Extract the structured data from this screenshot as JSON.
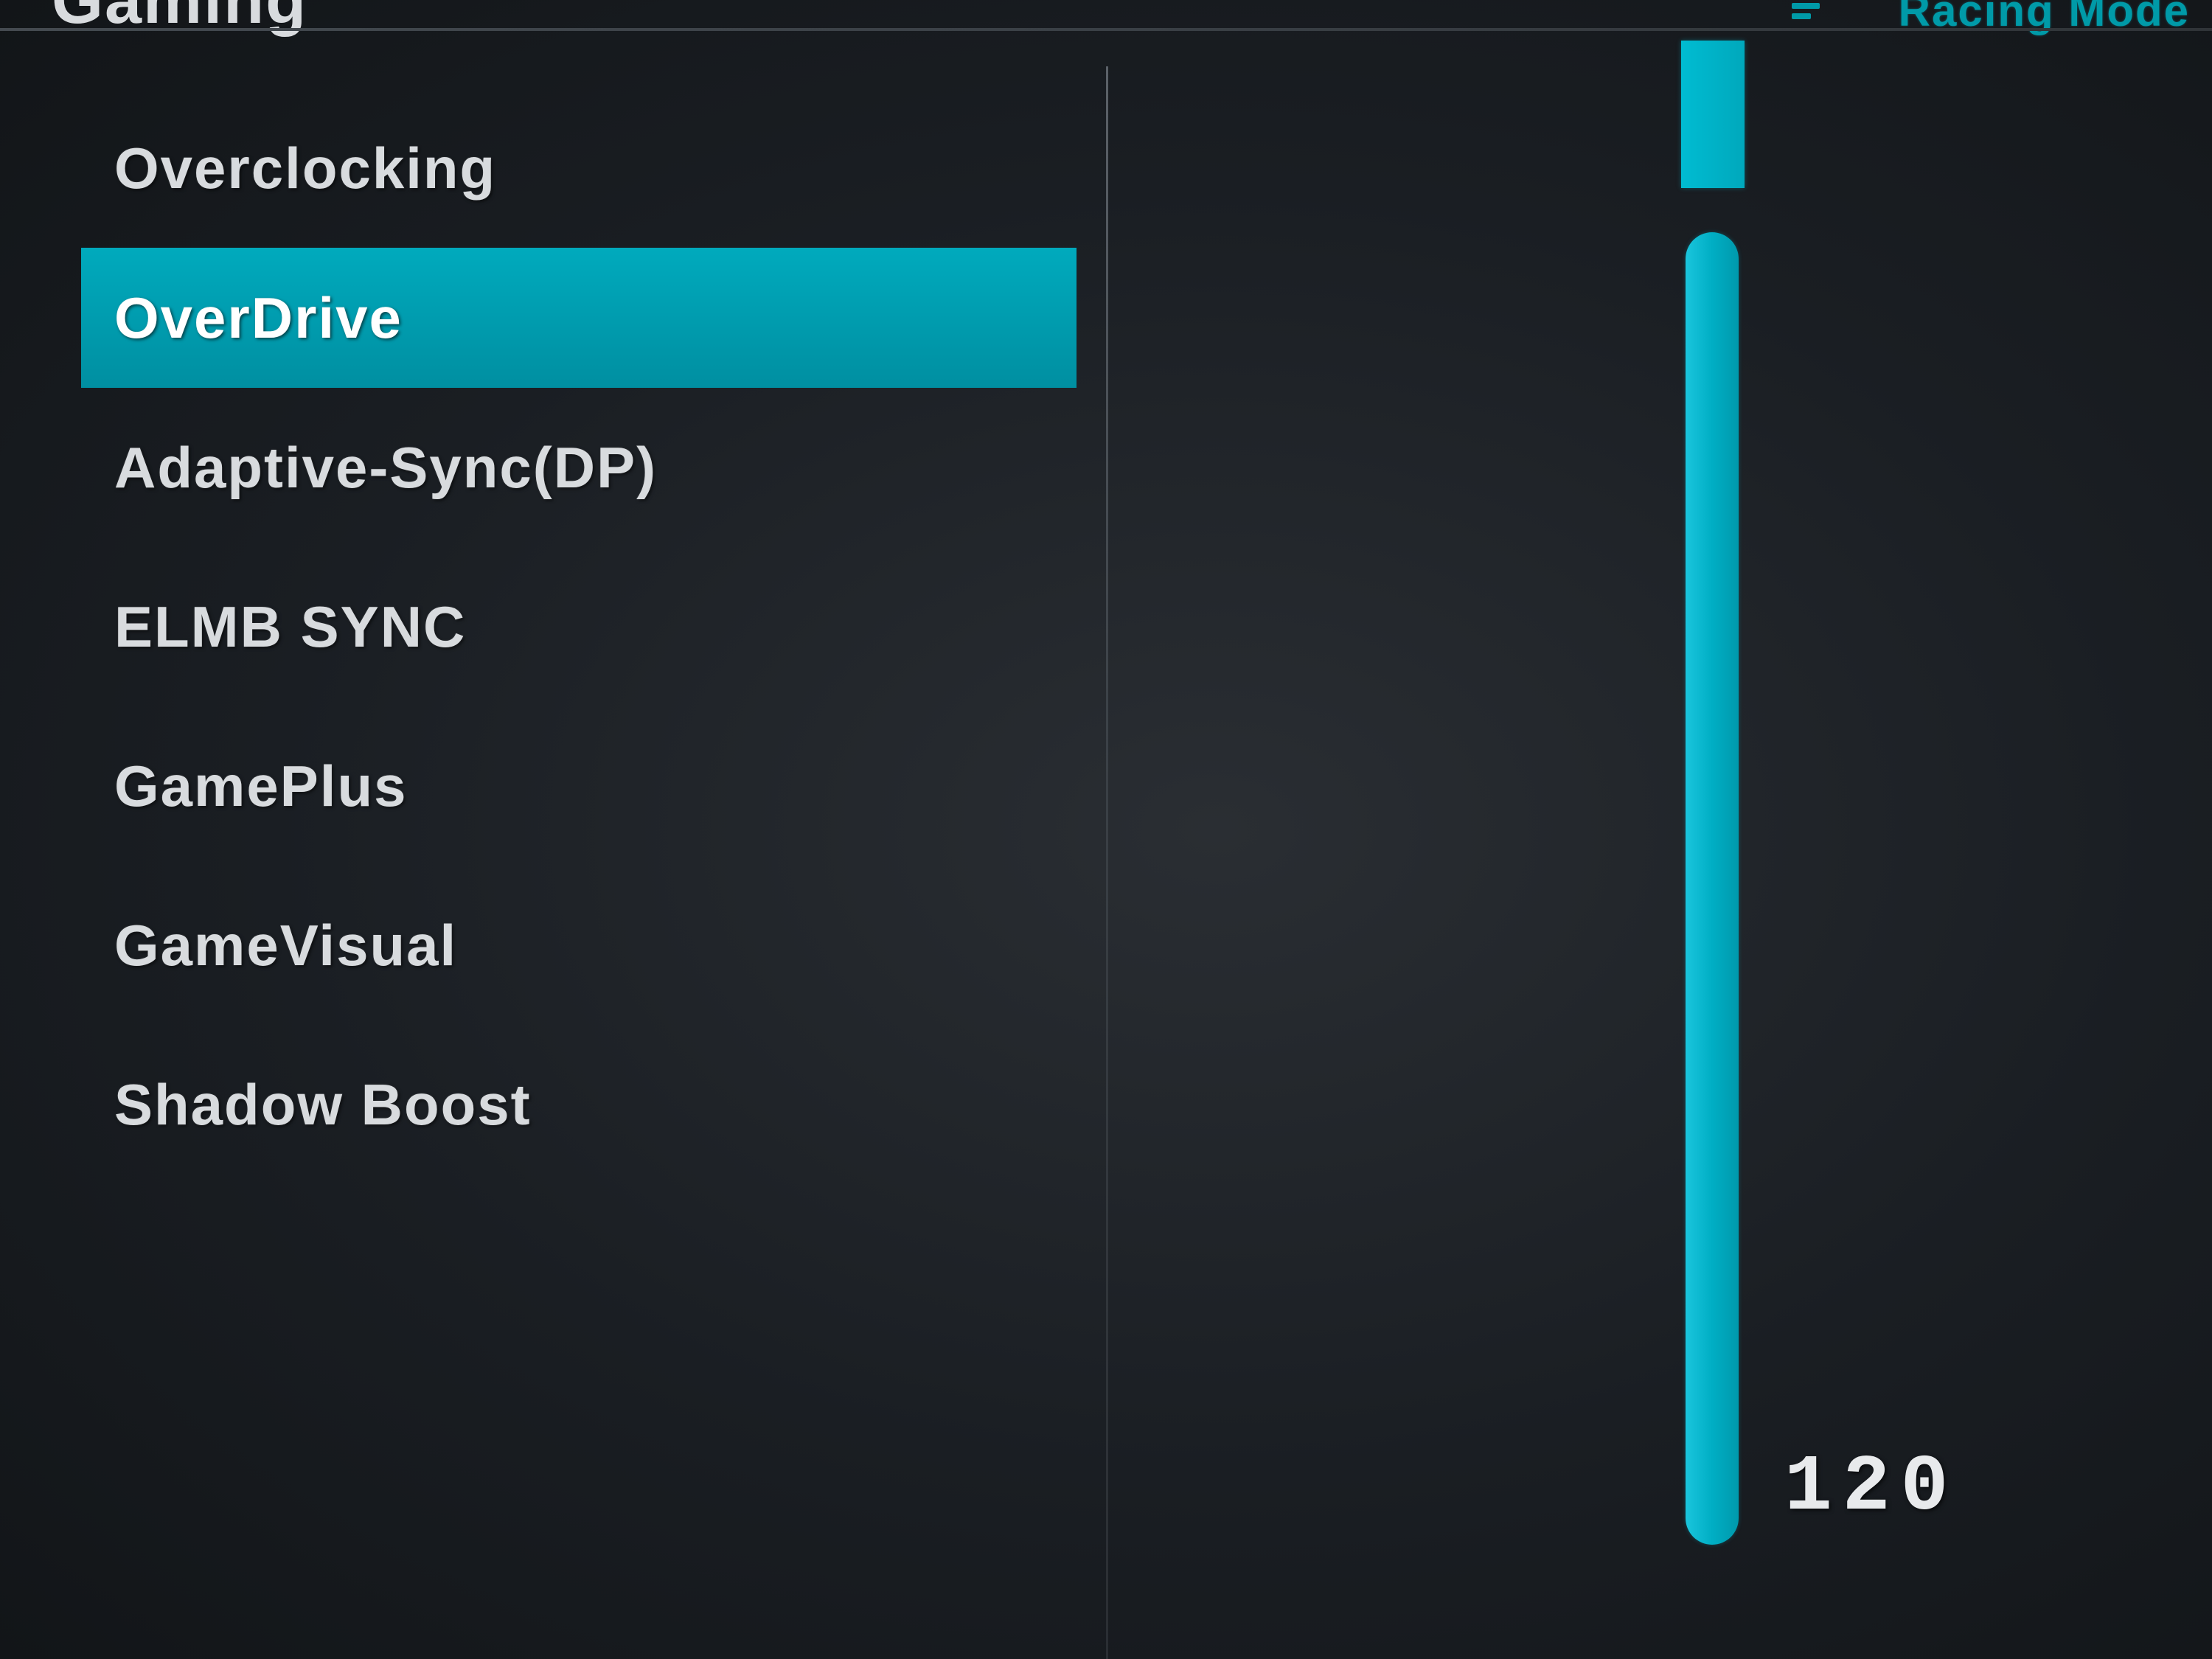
{
  "header": {
    "section_title": "Gaming",
    "mode_label": "Racing Mode"
  },
  "menu": {
    "items": [
      {
        "label": "Overclocking",
        "selected": false
      },
      {
        "label": "OverDrive",
        "selected": true
      },
      {
        "label": "Adaptive-Sync(DP)",
        "selected": false
      },
      {
        "label": "ELMB SYNC",
        "selected": false
      },
      {
        "label": "GamePlus",
        "selected": false
      },
      {
        "label": "GameVisual",
        "selected": false
      },
      {
        "label": "Shadow Boost",
        "selected": false
      }
    ]
  },
  "slider": {
    "value": "120"
  },
  "colors": {
    "accent": "#00aabd",
    "text": "#d8dbde",
    "background_dark": "#1a1e23"
  }
}
